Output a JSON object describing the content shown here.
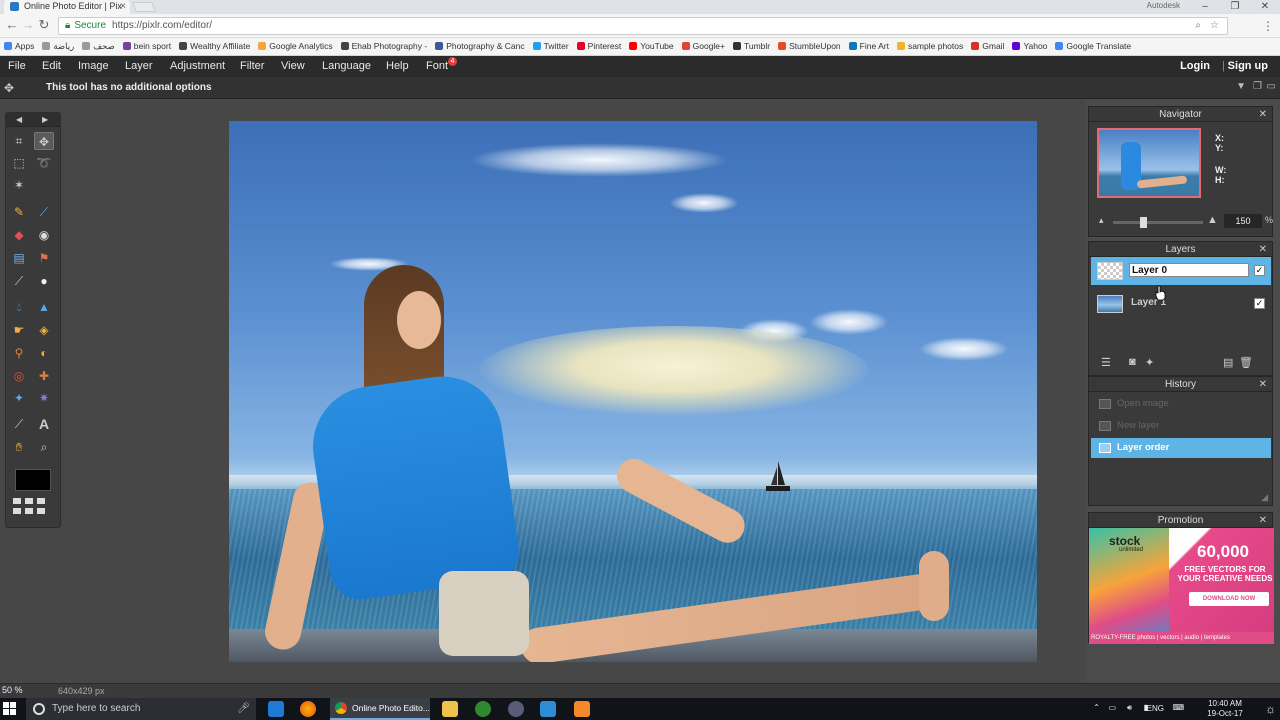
{
  "browser": {
    "tab_title": "Online Photo Editor | Pix",
    "user_label": "Autodesk",
    "secure_label": "Secure",
    "url": "https://pixlr.com/editor/",
    "bookmarks": [
      "Apps",
      "رياضة",
      "صحف",
      "bein sport",
      "Wealthy Affiliate",
      "Google Analytics",
      "Ehab Photography -",
      "Photography & Canc",
      "Twitter",
      "Pinterest",
      "YouTube",
      "Google+",
      "Tumblr",
      "StumbleUpon",
      "Fine Art",
      "sample photos",
      "Gmail",
      "Yahoo",
      "Google Translate"
    ],
    "bookmark_colors": [
      "#4285f4",
      "#999999",
      "#999999",
      "#7b3fa0",
      "#444444",
      "#f4a63a",
      "#444444",
      "#3b5998",
      "#1da1f2",
      "#e60023",
      "#ff0000",
      "#db4437",
      "#333333",
      "#eb4924",
      "#0b7bb8",
      "#f0b429",
      "#d93025",
      "#6001d2",
      "#4285f4"
    ]
  },
  "menu": {
    "items": [
      "File",
      "Edit",
      "Image",
      "Layer",
      "Adjustment",
      "Filter",
      "View",
      "Language",
      "Help",
      "Font"
    ],
    "font_badge": "4",
    "login": "Login",
    "signup": "Sign up"
  },
  "options_bar": {
    "tip": "This tool has no additional options"
  },
  "toolbox": {
    "selected_tool": "move-tool",
    "foreground_color": "#000000"
  },
  "status": {
    "zoom": "50",
    "zoom_unit": "%",
    "image_size": "640x429 px"
  },
  "navigator": {
    "title": "Navigator",
    "x_label": "X:",
    "y_label": "Y:",
    "w_label": "W:",
    "h_label": "H:",
    "zoom_value": "150",
    "zoom_unit": "%",
    "zoom_level_fraction": 0.33
  },
  "layers": {
    "title": "Layers",
    "items": [
      {
        "name": "Layer 0",
        "visible": "✓",
        "selected": true
      },
      {
        "name": "Layer 1",
        "visible": "✓",
        "selected": false
      }
    ]
  },
  "history": {
    "title": "History",
    "items": [
      "Open image",
      "New layer",
      "Layer order"
    ],
    "selected_index": 2
  },
  "promotion": {
    "title": "Promotion",
    "brand": "stock",
    "brand_sub": "unlimited",
    "count": "60,000",
    "headline": "FREE VECTORS FOR YOUR CREATIVE NEEDS",
    "cta": "DOWNLOAD NOW",
    "footer": "ROYALTY-FREE  photos | vectors | audio | templates"
  },
  "taskbar": {
    "search_placeholder": "Type here to search",
    "active_window": "Online Photo Edito...",
    "language": "ENG",
    "time": "10:40 AM",
    "date": "19-Oct-17"
  }
}
